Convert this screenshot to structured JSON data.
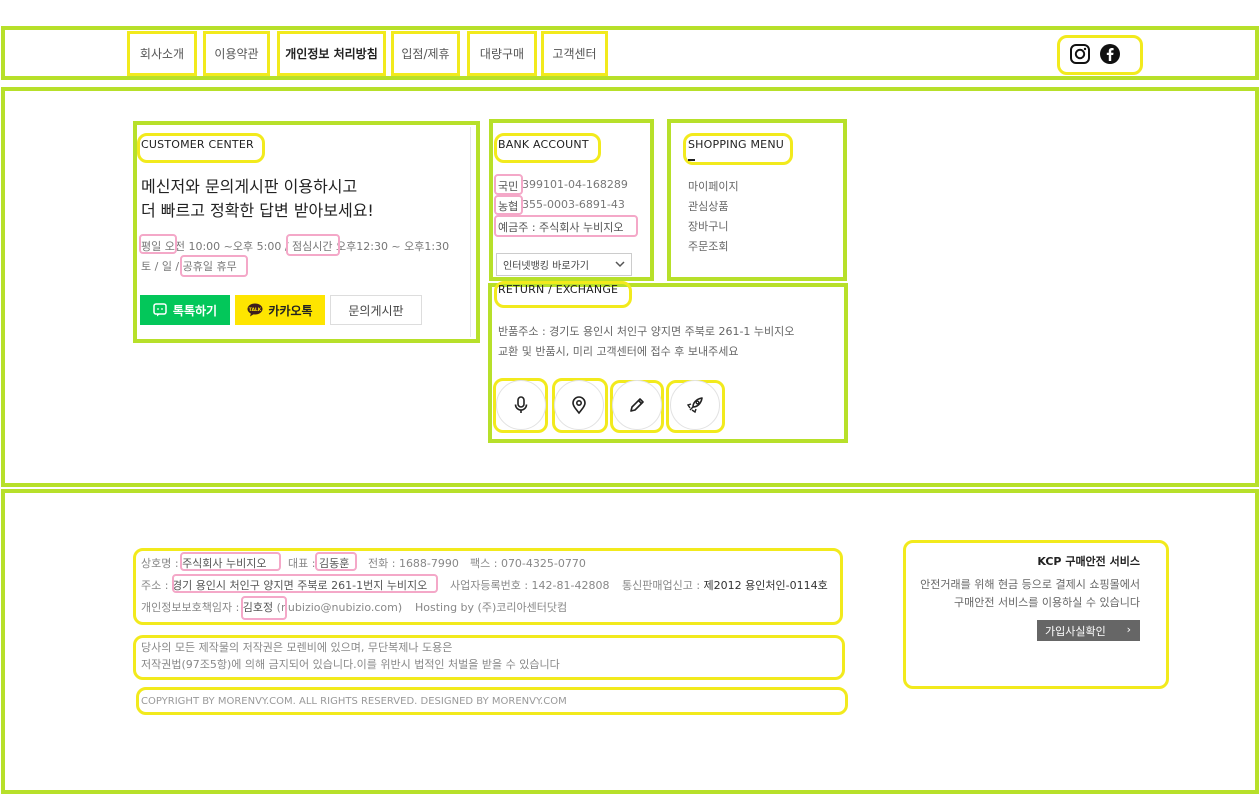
{
  "nav": {
    "items": [
      {
        "label": "회사소개"
      },
      {
        "label": "이용약관"
      },
      {
        "label": "개인정보 처리방침"
      },
      {
        "label": "입점/제휴"
      },
      {
        "label": "대량구매"
      },
      {
        "label": "고객센터"
      }
    ],
    "social": [
      "instagram-icon",
      "facebook-icon"
    ]
  },
  "customer_center": {
    "title": "CUSTOMER CENTER",
    "headline_1": "메신저와 문의게시판 이용하시고",
    "headline_2": "더 빠르고 정확한 답변 받아보세요!",
    "hours_1": "평일 오전 10:00 ~오후 5:00 / 점심시간 오후12:30 ~ 오후1:30",
    "hours_2": "토 / 일 / 공휴일 휴무",
    "btn_talk": "톡톡하기",
    "btn_kakao": "카카오톡",
    "btn_board": "문의게시판",
    "talk_color": "#03c75a",
    "kakao_color": "#fee500"
  },
  "bank": {
    "title": "BANK ACCOUNT",
    "acc1_bank": "국민",
    "acc1_no": "399101-04-168289",
    "acc2_bank": "농협",
    "acc2_no": "355-0003-6891-43",
    "holder": "예금주 : 주식회사 누비지오",
    "select_label": "인터넷뱅킹 바로가기"
  },
  "shopping": {
    "title": "SHOPPING MENU",
    "items": [
      "마이페이지",
      "관심상품",
      "장바구니",
      "주문조회"
    ]
  },
  "return": {
    "title": "RETURN / EXCHANGE",
    "line1": "반품주소 : 경기도 용인시 처인구 양지면 주북로 261-1 누비지오",
    "line2": "교환 및 반품시, 미리 고객센터에 접수 후 보내주세요",
    "icons": [
      "microphone-icon",
      "map-pin-icon",
      "pencil-icon",
      "rocket-icon"
    ]
  },
  "footer": {
    "company_label": "상호명 :",
    "company": "주식회사 누비지오",
    "ceo_label": "대표 :",
    "ceo": "김동훈",
    "phone": "전화 : 1688-7990",
    "fax": "팩스 : 070-4325-0770",
    "addr_label": "주소 :",
    "addr": "경기 용인시 처인구 양지면 주북로 261-1번지 누비지오",
    "biz": "사업자등록번호 : 142-81-42808",
    "mail_order_label": "통신판매업신고 :",
    "mail_order": "제2012 용인처인-0114호",
    "privacy_label": "개인정보보호책임자 :",
    "privacy": "김호정",
    "email": "(nubizio@nubizio.com)",
    "hosting": "Hosting by (주)코리아센터닷컴",
    "copy1": "당사의 모든 제작물의 저작권은 모렌비에 있으며, 무단복제나 도용은",
    "copy2": "저작권법(97조5항)에 의해 금지되어 있습니다.이를 위반시 법적인 처벌을 받을 수 있습니다",
    "copyright": "COPYRIGHT BY MORENVY.COM. ALL RIGHTS RESERVED. DESIGNED BY MORENVY.COM",
    "kcp_title": "KCP 구매안전 서비스",
    "kcp_desc1": "안전거래를 위해 현금 등으로 결제시 쇼핑몰에서",
    "kcp_desc2": "구매안전 서비스를 이용하실 수 있습니다",
    "kcp_btn": "가입사실확인",
    "kcp_btn_arrow": "›"
  }
}
